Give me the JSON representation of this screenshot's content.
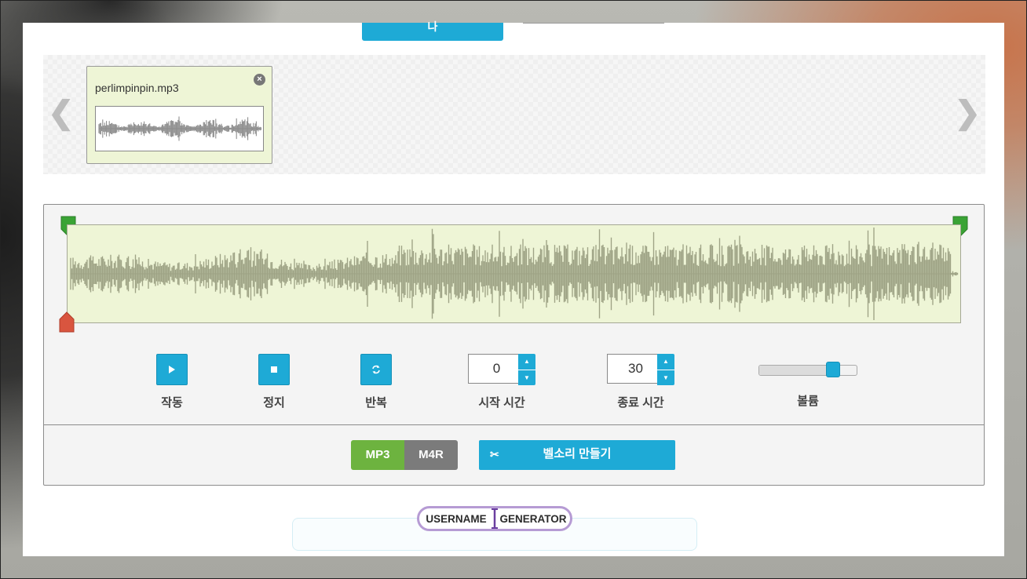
{
  "top_tab": {
    "label": "나"
  },
  "carousel": {
    "prev_arrow": "❮",
    "next_arrow": "❯",
    "file": {
      "name": "perlimpinpin.mp3",
      "close": "×"
    }
  },
  "controls": {
    "play": {
      "label": "작동",
      "icon": "play-icon"
    },
    "stop": {
      "label": "정지",
      "icon": "stop-icon"
    },
    "repeat": {
      "label": "반복",
      "icon": "repeat-icon"
    },
    "start_time": {
      "value": "0",
      "label": "시작 시간"
    },
    "end_time": {
      "value": "30",
      "label": "종료 시간"
    },
    "volume": {
      "label": "볼륨",
      "level": 0.8
    }
  },
  "format": {
    "mp3": "MP3",
    "m4r": "M4R",
    "selected": "MP3"
  },
  "make_button": {
    "label": "벨소리 만들기",
    "icon": "scissors-icon"
  },
  "logo": {
    "left": "USERNAME",
    "right": "GENERATOR"
  },
  "colors": {
    "accent": "#1eaad6",
    "green": "#6db33f",
    "wave": "#9ea385",
    "wave_bg": "#eef5d6",
    "marker_green": "#3aa335",
    "marker_red": "#d9553f"
  }
}
